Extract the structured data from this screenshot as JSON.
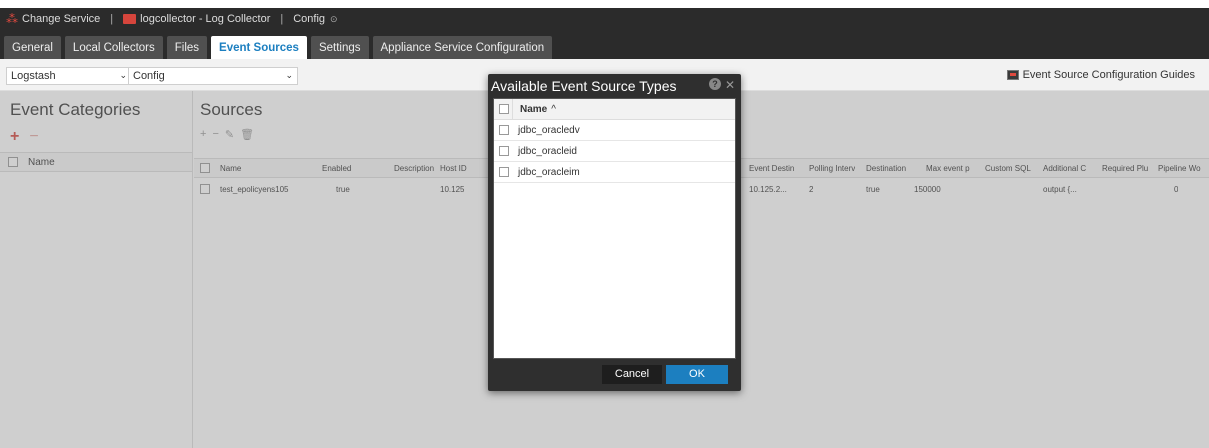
{
  "topbar": {
    "change_service": "Change Service",
    "separator": "|",
    "service_name": "logcollector - Log Collector",
    "separator2": "|",
    "config": "Config",
    "config_icon": "chevron-circle-icon"
  },
  "tabs": [
    {
      "label": "General"
    },
    {
      "label": "Local Collectors"
    },
    {
      "label": "Files"
    },
    {
      "label": "Event Sources"
    },
    {
      "label": "Settings"
    },
    {
      "label": "Appliance Service Configuration"
    }
  ],
  "toolbar": {
    "collector_select": "Logstash",
    "mode_select": "Config",
    "guides_link": "Event Source Configuration Guides"
  },
  "left": {
    "title": "Event Categories",
    "column_name": "Name"
  },
  "main": {
    "title": "Sources",
    "columns": [
      "Name",
      "Enabled",
      "Description",
      "Host ID",
      "Event Destin",
      "Polling Interv",
      "Destination",
      "Max event p",
      "Custom SQL",
      "Additional C",
      "Required Plu",
      "Pipeline Wo"
    ],
    "row": [
      "test_epolicyens105",
      "true",
      "10.125",
      "10.125.2...",
      "2",
      "true",
      "150000",
      "output {...",
      "0"
    ]
  },
  "modal": {
    "title": "Available Event Source Types",
    "column_name": "Name",
    "sort_indicator": "^",
    "items": [
      {
        "name": "jdbc_oracledv"
      },
      {
        "name": "jdbc_oracleid"
      },
      {
        "name": "jdbc_oracleim"
      }
    ],
    "cancel_label": "Cancel",
    "ok_label": "OK"
  },
  "colors": {
    "accent_blue": "#1c7fc0",
    "add_red": "#d6453c",
    "dark_bar": "#2b2b2b"
  }
}
